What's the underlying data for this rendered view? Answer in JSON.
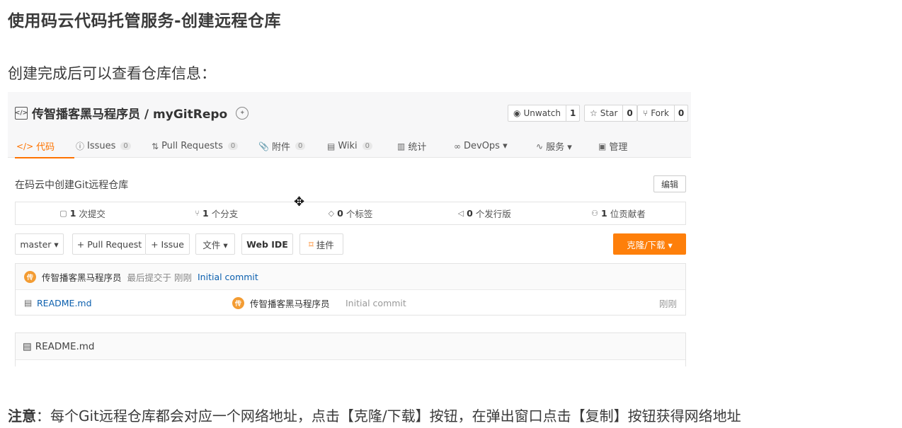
{
  "slide": {
    "title": "使用码云代码托管服务-创建远程仓库",
    "subtitle": "创建完成后可以查看仓库信息：",
    "note_bold": "注意",
    "note_text": "：每个Git远程仓库都会对应一个网络地址，点击【克隆/下载】按钮，在弹出窗口点击【复制】按钮获得网络地址"
  },
  "repo": {
    "title": "传智播客黑马程序员 / myGitRepo",
    "description": "在码云中创建Git远程仓库",
    "edit_label": "编辑",
    "actions": [
      {
        "icon": "eye-icon",
        "glyph": "◉",
        "label": "Unwatch",
        "count": "1"
      },
      {
        "icon": "star-icon",
        "glyph": "☆",
        "label": "Star",
        "count": "0"
      },
      {
        "icon": "fork-icon",
        "glyph": "⑂",
        "label": "Fork",
        "count": "0"
      }
    ]
  },
  "tabs": [
    {
      "glyph": "</>",
      "icon": "code-icon",
      "label": "代码",
      "count": ""
    },
    {
      "glyph": "ⓘ",
      "icon": "issues-icon",
      "label": "Issues",
      "count": "0"
    },
    {
      "glyph": "⇅",
      "icon": "pull-request-icon",
      "label": "Pull Requests",
      "count": "0"
    },
    {
      "glyph": "📎",
      "icon": "attachment-icon",
      "label": "附件",
      "count": "0"
    },
    {
      "glyph": "▤",
      "icon": "wiki-icon",
      "label": "Wiki",
      "count": "0"
    },
    {
      "glyph": "▥",
      "icon": "stats-icon",
      "label": "统计",
      "count": ""
    },
    {
      "glyph": "∞",
      "icon": "devops-icon",
      "label": "DevOps ▾",
      "count": ""
    },
    {
      "glyph": "∿",
      "icon": "services-icon",
      "label": "服务 ▾",
      "count": ""
    },
    {
      "glyph": "▣",
      "icon": "manage-icon",
      "label": "管理",
      "count": ""
    }
  ],
  "stats": [
    {
      "glyph": "▢",
      "icon": "commit-icon",
      "num": "1",
      "label": "次提交"
    },
    {
      "glyph": "⑂",
      "icon": "branch-icon",
      "num": "1",
      "label": "个分支"
    },
    {
      "glyph": "◇",
      "icon": "tag-icon",
      "num": "0",
      "label": "个标签"
    },
    {
      "glyph": "◁",
      "icon": "release-icon",
      "num": "0",
      "label": "个发行版"
    },
    {
      "glyph": "⚇",
      "icon": "contributor-icon",
      "num": "1",
      "label": "位贡献者"
    }
  ],
  "toolbar": {
    "branch": "master ▾",
    "pull_request": "+ Pull Request",
    "issue": "+ Issue",
    "files": "文件 ▾",
    "web_ide": "Web IDE",
    "widget": "挂件",
    "clone": "克隆/下载 ▾"
  },
  "commit": {
    "avatar_char": "传",
    "author": "传智播客黑马程序员",
    "meta": "最后提交于 刚刚",
    "message": "Initial commit"
  },
  "files": [
    {
      "name": "README.md",
      "author": "传智播客黑马程序员",
      "avatar_char": "传",
      "message": "Initial commit",
      "time": "刚刚"
    }
  ],
  "readme": {
    "title": "README.md"
  }
}
